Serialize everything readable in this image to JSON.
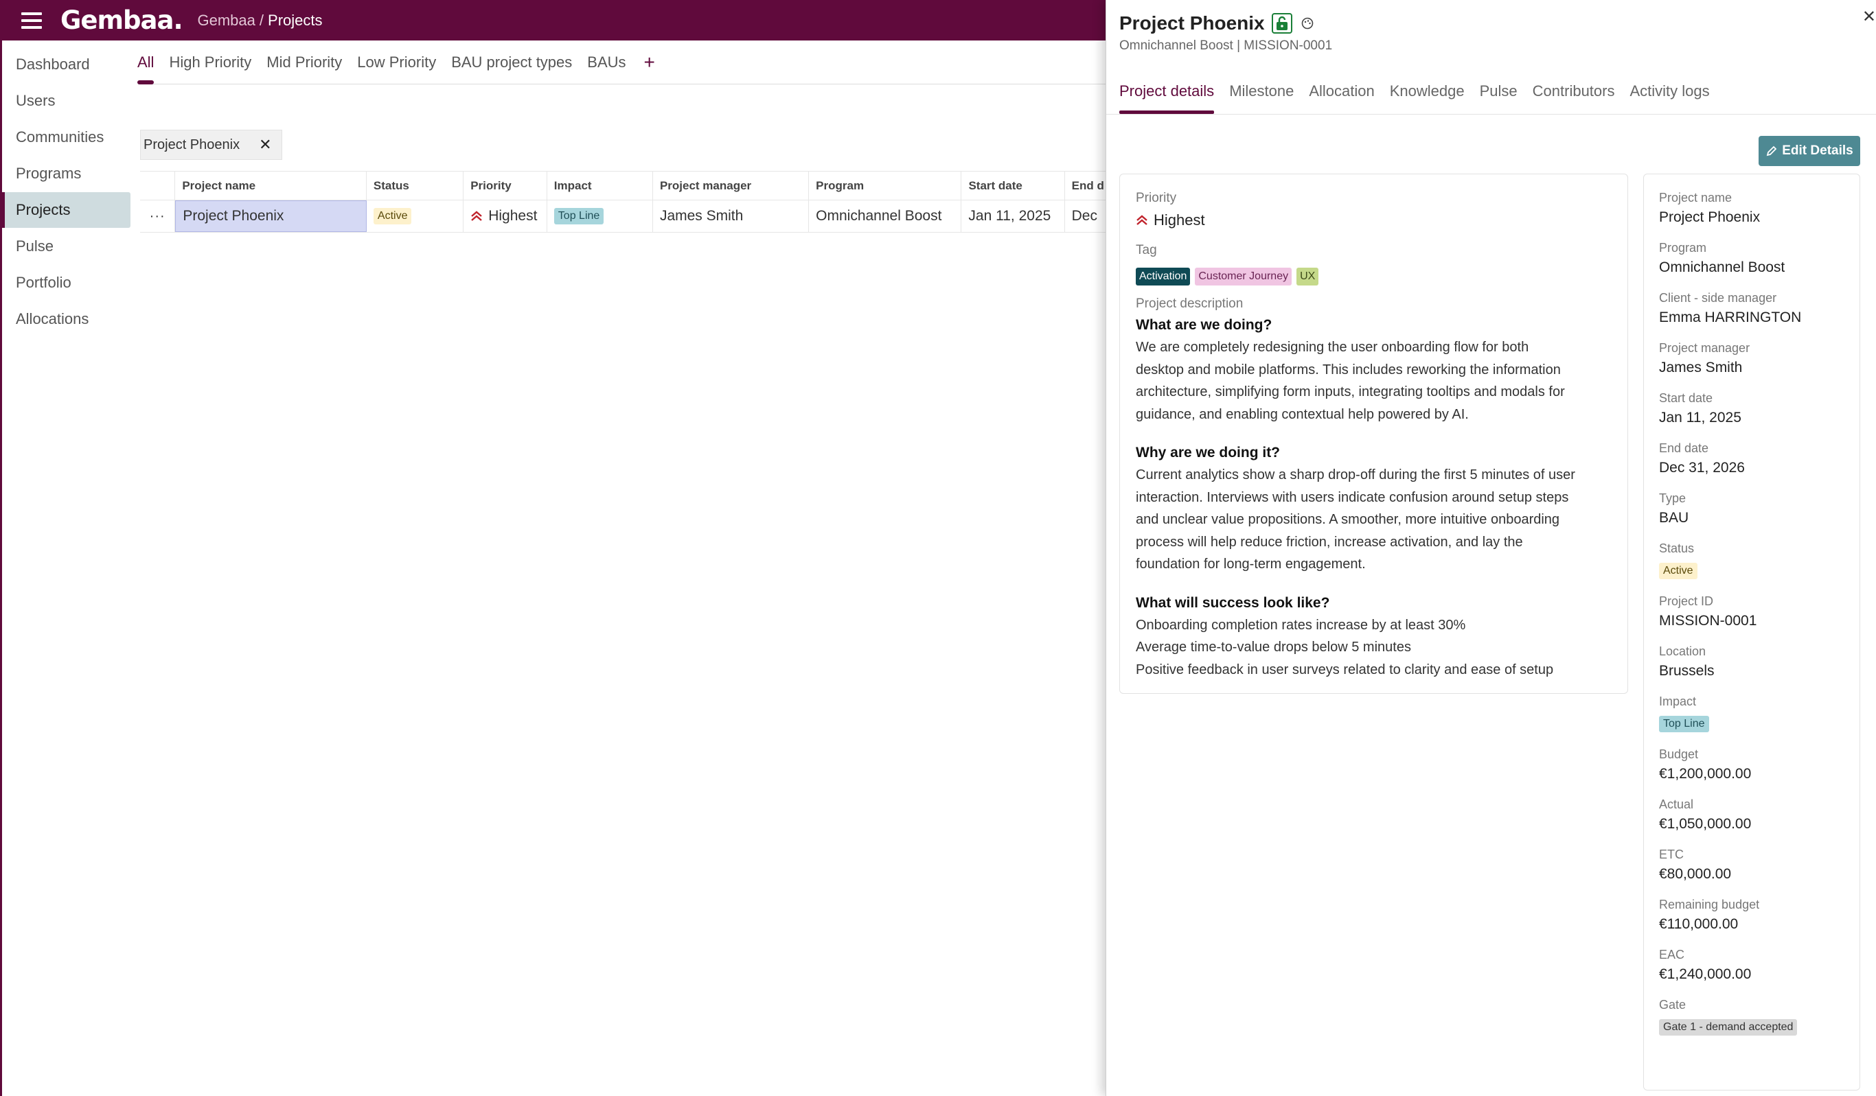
{
  "app": {
    "logo": "Gembaa.",
    "breadcrumb_root": "Gembaa",
    "breadcrumb_sep": "/",
    "breadcrumb_current": "Projects"
  },
  "sidebar": {
    "items": [
      {
        "label": "Dashboard"
      },
      {
        "label": "Users"
      },
      {
        "label": "Communities"
      },
      {
        "label": "Programs"
      },
      {
        "label": "Projects"
      },
      {
        "label": "Pulse"
      },
      {
        "label": "Portfolio"
      },
      {
        "label": "Allocations"
      }
    ]
  },
  "views": {
    "tabs": [
      "All",
      "High Priority",
      "Mid Priority",
      "Low Priority",
      "BAU project types",
      "BAUs"
    ],
    "add": "+"
  },
  "filter_chip": {
    "label": "Project Phoenix",
    "close": "✕"
  },
  "table": {
    "headers": [
      "Project name",
      "Status",
      "Priority",
      "Impact",
      "Project manager",
      "Program",
      "Start date",
      "End d"
    ],
    "row": {
      "actions": "···",
      "project_name": "Project Phoenix",
      "status": "Active",
      "priority": "Highest",
      "impact": "Top Line",
      "project_manager": "James Smith",
      "program": "Omnichannel Boost",
      "start_date": "Jan 11, 2025",
      "end_date": "Dec"
    }
  },
  "drawer": {
    "title": "Project Phoenix",
    "subtitle": "Omnichannel Boost | MISSION-0001",
    "close": "✕",
    "tabs": [
      "Project details",
      "Milestone",
      "Allocation",
      "Knowledge",
      "Pulse",
      "Contributors",
      "Activity logs"
    ],
    "edit_label": "Edit Details",
    "left": {
      "priority_label": "Priority",
      "priority_value": "Highest",
      "tag_label": "Tag",
      "tags": [
        "Activation",
        "Customer Journey",
        "UX"
      ],
      "desc_label": "Project description",
      "sections": [
        {
          "heading": "What are we doing?",
          "lines": [
            "We are completely redesigning the user onboarding flow for both",
            "desktop and mobile platforms. This includes reworking the information",
            "architecture, simplifying form inputs, integrating tooltips and modals for",
            "guidance, and enabling contextual help powered by AI."
          ]
        },
        {
          "heading": "Why are we doing it?",
          "lines": [
            "Current analytics show a sharp drop-off during the first 5 minutes of user",
            "interaction. Interviews with users indicate confusion around setup steps",
            "and unclear value propositions. A smoother, more intuitive onboarding",
            "process will help reduce friction, increase activation, and lay the",
            "foundation for long-term engagement."
          ]
        },
        {
          "heading": "What will success look like?",
          "lines": [
            "Onboarding completion rates increase by at least 30%",
            "Average time-to-value drops below 5 minutes",
            "Positive feedback in user surveys related to clarity and ease of setup"
          ]
        }
      ]
    },
    "right": {
      "project_name": {
        "label": "Project name",
        "value": "Project Phoenix"
      },
      "program": {
        "label": "Program",
        "value": "Omnichannel Boost"
      },
      "client_manager": {
        "label": "Client - side manager",
        "value": "Emma HARRINGTON"
      },
      "project_manager": {
        "label": "Project manager",
        "value": "James Smith"
      },
      "start_date": {
        "label": "Start date",
        "value": "Jan 11, 2025"
      },
      "end_date": {
        "label": "End date",
        "value": "Dec 31, 2026"
      },
      "type": {
        "label": "Type",
        "value": "BAU"
      },
      "status": {
        "label": "Status",
        "value": "Active"
      },
      "project_id": {
        "label": "Project ID",
        "value": "MISSION-0001"
      },
      "location": {
        "label": "Location",
        "value": "Brussels"
      },
      "impact": {
        "label": "Impact",
        "value": "Top Line"
      },
      "budget": {
        "label": "Budget",
        "value": "€1,200,000.00"
      },
      "actual": {
        "label": "Actual",
        "value": "€1,050,000.00"
      },
      "etc": {
        "label": "ETC",
        "value": "€80,000.00"
      },
      "remaining": {
        "label": "Remaining budget",
        "value": "€110,000.00"
      },
      "eac": {
        "label": "EAC",
        "value": "€1,240,000.00"
      },
      "gate": {
        "label": "Gate",
        "value": "Gate 1 - demand accepted"
      }
    }
  },
  "colors": {
    "brand": "#600a3c",
    "accent": "#4e8993",
    "priority": "#c0232c"
  }
}
